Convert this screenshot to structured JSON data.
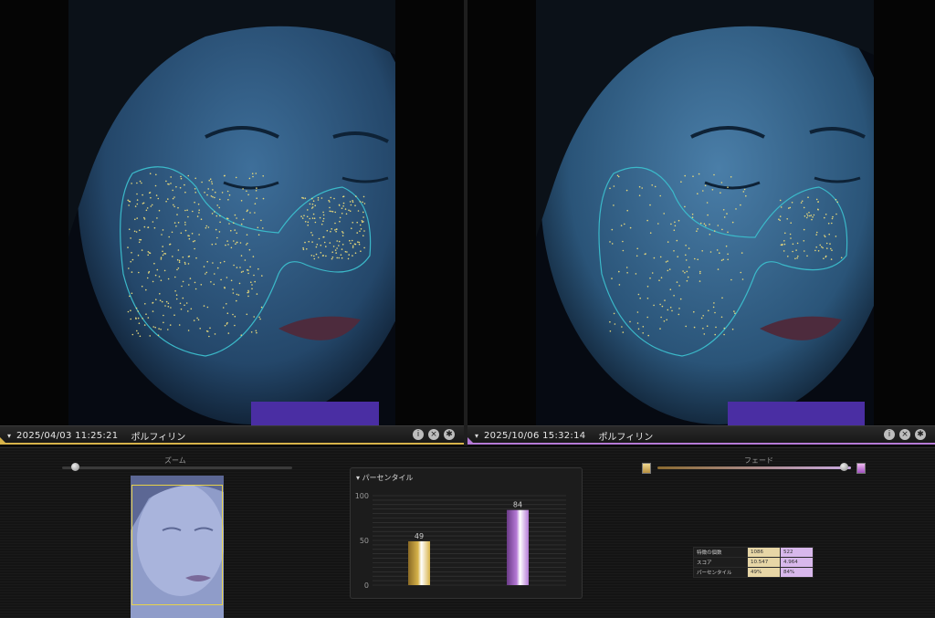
{
  "left_panel": {
    "timestamp": "2025/04/03 11:25:21",
    "mode": "ポルフィリン",
    "arrow_icon": "▾",
    "accent": "#d7b34a"
  },
  "right_panel": {
    "timestamp": "2025/10/06 15:32:14",
    "mode": "ポルフィリン",
    "arrow_icon": "▾",
    "accent": "#b57ad6"
  },
  "toolbar_icons": [
    "info-icon",
    "close-icon",
    "settings-icon"
  ],
  "zoom": {
    "label": "ズーム",
    "level": 0.05
  },
  "fade": {
    "label": "フェード",
    "level": 0.97
  },
  "percentile_chart": {
    "title": "パーセンタイル",
    "arrow_icon": "▾"
  },
  "chart_data": {
    "type": "bar",
    "title": "パーセンタイル",
    "categories": [
      "",
      ""
    ],
    "values": [
      49,
      84
    ],
    "value_labels": [
      "49",
      "84"
    ],
    "ylim": [
      0,
      100
    ],
    "yticks": [
      "0",
      "50",
      "100"
    ],
    "colors": [
      "#d7b34a",
      "#b57ad6"
    ],
    "grid": true
  },
  "stats": {
    "rows": [
      {
        "label": "特徴の個数",
        "a": "1086",
        "b": "522"
      },
      {
        "label": "スコア",
        "a": "10.547",
        "b": "4.964"
      },
      {
        "label": "パーセンタイル",
        "a": "49%",
        "b": "84%"
      }
    ]
  }
}
